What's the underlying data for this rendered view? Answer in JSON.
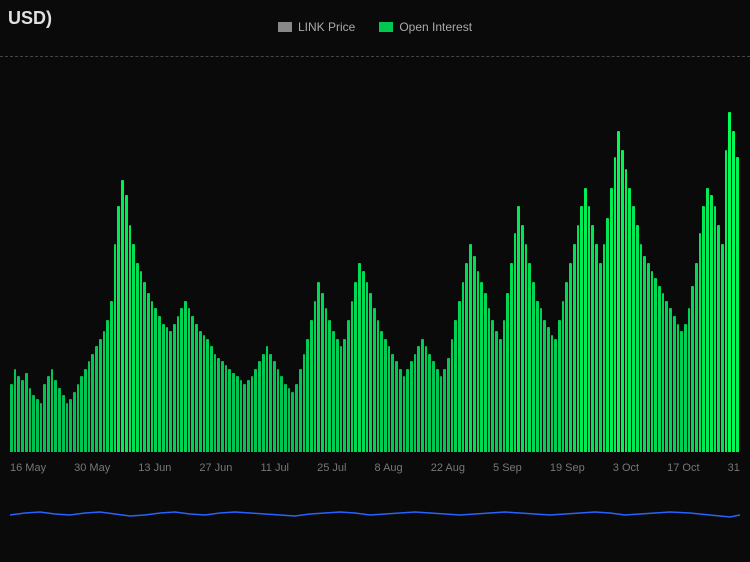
{
  "title": "USD)",
  "legend": {
    "link_price_label": "LINK Price",
    "open_interest_label": "Open Interest",
    "link_price_color": "#888",
    "open_interest_color": "#00c853"
  },
  "x_axis_labels": [
    "16 May",
    "30 May",
    "13 Jun",
    "27 Jun",
    "11 Jul",
    "25 Jul",
    "8 Aug",
    "22 Aug",
    "5 Sep",
    "19 Sep",
    "3 Oct",
    "17 Oct",
    "31"
  ],
  "bars": [
    18,
    22,
    20,
    19,
    21,
    17,
    15,
    14,
    13,
    18,
    20,
    22,
    19,
    17,
    15,
    13,
    14,
    16,
    18,
    20,
    22,
    24,
    26,
    28,
    30,
    32,
    35,
    40,
    55,
    65,
    72,
    68,
    60,
    55,
    50,
    48,
    45,
    42,
    40,
    38,
    36,
    34,
    33,
    32,
    34,
    36,
    38,
    40,
    38,
    36,
    34,
    32,
    31,
    30,
    28,
    26,
    25,
    24,
    23,
    22,
    21,
    20,
    19,
    18,
    19,
    20,
    22,
    24,
    26,
    28,
    26,
    24,
    22,
    20,
    18,
    17,
    16,
    18,
    22,
    26,
    30,
    35,
    40,
    45,
    42,
    38,
    35,
    32,
    30,
    28,
    30,
    35,
    40,
    45,
    50,
    48,
    45,
    42,
    38,
    35,
    32,
    30,
    28,
    26,
    24,
    22,
    20,
    22,
    24,
    26,
    28,
    30,
    28,
    26,
    24,
    22,
    20,
    22,
    25,
    30,
    35,
    40,
    45,
    50,
    55,
    52,
    48,
    45,
    42,
    38,
    35,
    32,
    30,
    35,
    42,
    50,
    58,
    65,
    60,
    55,
    50,
    45,
    40,
    38,
    35,
    33,
    31,
    30,
    35,
    40,
    45,
    50,
    55,
    60,
    65,
    70,
    65,
    60,
    55,
    50,
    55,
    62,
    70,
    78,
    85,
    80,
    75,
    70,
    65,
    60,
    55,
    52,
    50,
    48,
    46,
    44,
    42,
    40,
    38,
    36,
    34,
    32,
    34,
    38,
    44,
    50,
    58,
    65,
    70,
    68,
    65,
    60,
    55,
    80,
    90,
    85,
    78
  ],
  "price_line_points": "0,38 15,36 30,35 45,37 60,38 75,36 90,35 105,37 120,39 135,38 150,36 165,35 180,37 195,38 210,36 225,35 240,36 255,37 270,38 285,39 300,37 315,36 330,35 345,36 360,38 375,37 390,36 405,35 420,36 435,37 450,38 465,37 480,36 495,35 510,36 525,37 540,38 555,37 570,36 585,35 600,36 615,38 630,37 645,36 660,35 680,36 700,38 720,40 730,38"
}
